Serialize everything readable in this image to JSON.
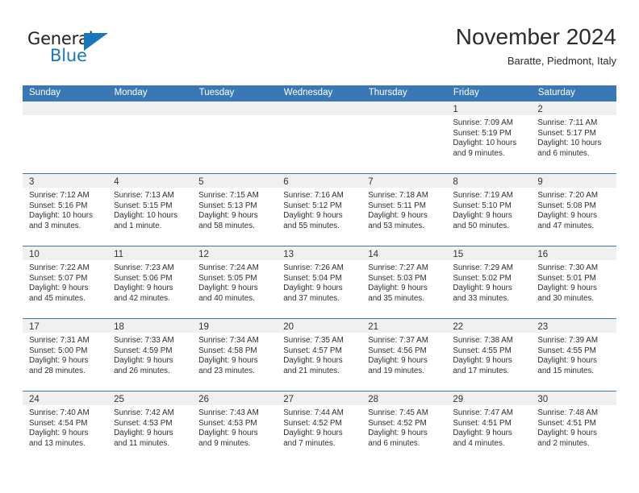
{
  "brand": {
    "name_top": "General",
    "name_bottom": "Blue",
    "accent_color": "#1b75bb"
  },
  "header": {
    "title": "November 2024",
    "subtitle": "Baratte, Piedmont, Italy"
  },
  "theme": {
    "header_blue": "#3a78b5",
    "date_band_gray": "#f0f0f0",
    "text_color": "#2e2e2e"
  },
  "weekdays": [
    "Sunday",
    "Monday",
    "Tuesday",
    "Wednesday",
    "Thursday",
    "Friday",
    "Saturday"
  ],
  "weeks": [
    [
      {
        "day": "",
        "sunrise": "",
        "sunset": "",
        "daylight_1": "",
        "daylight_2": ""
      },
      {
        "day": "",
        "sunrise": "",
        "sunset": "",
        "daylight_1": "",
        "daylight_2": ""
      },
      {
        "day": "",
        "sunrise": "",
        "sunset": "",
        "daylight_1": "",
        "daylight_2": ""
      },
      {
        "day": "",
        "sunrise": "",
        "sunset": "",
        "daylight_1": "",
        "daylight_2": ""
      },
      {
        "day": "",
        "sunrise": "",
        "sunset": "",
        "daylight_1": "",
        "daylight_2": ""
      },
      {
        "day": "1",
        "sunrise": "Sunrise: 7:09 AM",
        "sunset": "Sunset: 5:19 PM",
        "daylight_1": "Daylight: 10 hours",
        "daylight_2": "and 9 minutes."
      },
      {
        "day": "2",
        "sunrise": "Sunrise: 7:11 AM",
        "sunset": "Sunset: 5:17 PM",
        "daylight_1": "Daylight: 10 hours",
        "daylight_2": "and 6 minutes."
      }
    ],
    [
      {
        "day": "3",
        "sunrise": "Sunrise: 7:12 AM",
        "sunset": "Sunset: 5:16 PM",
        "daylight_1": "Daylight: 10 hours",
        "daylight_2": "and 3 minutes."
      },
      {
        "day": "4",
        "sunrise": "Sunrise: 7:13 AM",
        "sunset": "Sunset: 5:15 PM",
        "daylight_1": "Daylight: 10 hours",
        "daylight_2": "and 1 minute."
      },
      {
        "day": "5",
        "sunrise": "Sunrise: 7:15 AM",
        "sunset": "Sunset: 5:13 PM",
        "daylight_1": "Daylight: 9 hours",
        "daylight_2": "and 58 minutes."
      },
      {
        "day": "6",
        "sunrise": "Sunrise: 7:16 AM",
        "sunset": "Sunset: 5:12 PM",
        "daylight_1": "Daylight: 9 hours",
        "daylight_2": "and 55 minutes."
      },
      {
        "day": "7",
        "sunrise": "Sunrise: 7:18 AM",
        "sunset": "Sunset: 5:11 PM",
        "daylight_1": "Daylight: 9 hours",
        "daylight_2": "and 53 minutes."
      },
      {
        "day": "8",
        "sunrise": "Sunrise: 7:19 AM",
        "sunset": "Sunset: 5:10 PM",
        "daylight_1": "Daylight: 9 hours",
        "daylight_2": "and 50 minutes."
      },
      {
        "day": "9",
        "sunrise": "Sunrise: 7:20 AM",
        "sunset": "Sunset: 5:08 PM",
        "daylight_1": "Daylight: 9 hours",
        "daylight_2": "and 47 minutes."
      }
    ],
    [
      {
        "day": "10",
        "sunrise": "Sunrise: 7:22 AM",
        "sunset": "Sunset: 5:07 PM",
        "daylight_1": "Daylight: 9 hours",
        "daylight_2": "and 45 minutes."
      },
      {
        "day": "11",
        "sunrise": "Sunrise: 7:23 AM",
        "sunset": "Sunset: 5:06 PM",
        "daylight_1": "Daylight: 9 hours",
        "daylight_2": "and 42 minutes."
      },
      {
        "day": "12",
        "sunrise": "Sunrise: 7:24 AM",
        "sunset": "Sunset: 5:05 PM",
        "daylight_1": "Daylight: 9 hours",
        "daylight_2": "and 40 minutes."
      },
      {
        "day": "13",
        "sunrise": "Sunrise: 7:26 AM",
        "sunset": "Sunset: 5:04 PM",
        "daylight_1": "Daylight: 9 hours",
        "daylight_2": "and 37 minutes."
      },
      {
        "day": "14",
        "sunrise": "Sunrise: 7:27 AM",
        "sunset": "Sunset: 5:03 PM",
        "daylight_1": "Daylight: 9 hours",
        "daylight_2": "and 35 minutes."
      },
      {
        "day": "15",
        "sunrise": "Sunrise: 7:29 AM",
        "sunset": "Sunset: 5:02 PM",
        "daylight_1": "Daylight: 9 hours",
        "daylight_2": "and 33 minutes."
      },
      {
        "day": "16",
        "sunrise": "Sunrise: 7:30 AM",
        "sunset": "Sunset: 5:01 PM",
        "daylight_1": "Daylight: 9 hours",
        "daylight_2": "and 30 minutes."
      }
    ],
    [
      {
        "day": "17",
        "sunrise": "Sunrise: 7:31 AM",
        "sunset": "Sunset: 5:00 PM",
        "daylight_1": "Daylight: 9 hours",
        "daylight_2": "and 28 minutes."
      },
      {
        "day": "18",
        "sunrise": "Sunrise: 7:33 AM",
        "sunset": "Sunset: 4:59 PM",
        "daylight_1": "Daylight: 9 hours",
        "daylight_2": "and 26 minutes."
      },
      {
        "day": "19",
        "sunrise": "Sunrise: 7:34 AM",
        "sunset": "Sunset: 4:58 PM",
        "daylight_1": "Daylight: 9 hours",
        "daylight_2": "and 23 minutes."
      },
      {
        "day": "20",
        "sunrise": "Sunrise: 7:35 AM",
        "sunset": "Sunset: 4:57 PM",
        "daylight_1": "Daylight: 9 hours",
        "daylight_2": "and 21 minutes."
      },
      {
        "day": "21",
        "sunrise": "Sunrise: 7:37 AM",
        "sunset": "Sunset: 4:56 PM",
        "daylight_1": "Daylight: 9 hours",
        "daylight_2": "and 19 minutes."
      },
      {
        "day": "22",
        "sunrise": "Sunrise: 7:38 AM",
        "sunset": "Sunset: 4:55 PM",
        "daylight_1": "Daylight: 9 hours",
        "daylight_2": "and 17 minutes."
      },
      {
        "day": "23",
        "sunrise": "Sunrise: 7:39 AM",
        "sunset": "Sunset: 4:55 PM",
        "daylight_1": "Daylight: 9 hours",
        "daylight_2": "and 15 minutes."
      }
    ],
    [
      {
        "day": "24",
        "sunrise": "Sunrise: 7:40 AM",
        "sunset": "Sunset: 4:54 PM",
        "daylight_1": "Daylight: 9 hours",
        "daylight_2": "and 13 minutes."
      },
      {
        "day": "25",
        "sunrise": "Sunrise: 7:42 AM",
        "sunset": "Sunset: 4:53 PM",
        "daylight_1": "Daylight: 9 hours",
        "daylight_2": "and 11 minutes."
      },
      {
        "day": "26",
        "sunrise": "Sunrise: 7:43 AM",
        "sunset": "Sunset: 4:53 PM",
        "daylight_1": "Daylight: 9 hours",
        "daylight_2": "and 9 minutes."
      },
      {
        "day": "27",
        "sunrise": "Sunrise: 7:44 AM",
        "sunset": "Sunset: 4:52 PM",
        "daylight_1": "Daylight: 9 hours",
        "daylight_2": "and 7 minutes."
      },
      {
        "day": "28",
        "sunrise": "Sunrise: 7:45 AM",
        "sunset": "Sunset: 4:52 PM",
        "daylight_1": "Daylight: 9 hours",
        "daylight_2": "and 6 minutes."
      },
      {
        "day": "29",
        "sunrise": "Sunrise: 7:47 AM",
        "sunset": "Sunset: 4:51 PM",
        "daylight_1": "Daylight: 9 hours",
        "daylight_2": "and 4 minutes."
      },
      {
        "day": "30",
        "sunrise": "Sunrise: 7:48 AM",
        "sunset": "Sunset: 4:51 PM",
        "daylight_1": "Daylight: 9 hours",
        "daylight_2": "and 2 minutes."
      }
    ]
  ]
}
